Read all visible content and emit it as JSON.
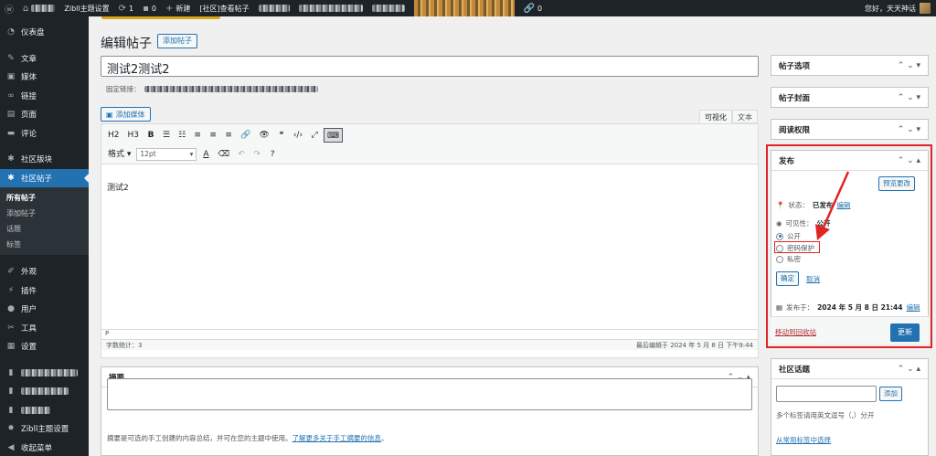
{
  "admin_bar": {
    "items": [
      {
        "icon": "wordpress-icon",
        "label": ""
      },
      {
        "icon": "home-icon",
        "label": "",
        "blurred": true
      },
      {
        "icon": "",
        "label": "Zibll主题设置"
      },
      {
        "icon": "refresh-icon",
        "label": "1"
      },
      {
        "icon": "comment-icon",
        "label": "0"
      },
      {
        "icon": "plus-icon",
        "label": "新建"
      },
      {
        "icon": "",
        "label": "[社区]查看帖子"
      }
    ],
    "links_count": "0",
    "greeting": "您好，天天神话"
  },
  "sidebar": {
    "items": [
      {
        "icon": "dashboard-icon",
        "label": "仪表盘"
      },
      {
        "sep": true
      },
      {
        "icon": "pin-icon",
        "label": "文章"
      },
      {
        "icon": "media-icon",
        "label": "媒体"
      },
      {
        "icon": "link-icon",
        "label": "链接"
      },
      {
        "icon": "page-icon",
        "label": "页面"
      },
      {
        "icon": "comment-icon",
        "label": "评论"
      },
      {
        "sep": true
      },
      {
        "icon": "forum-icon",
        "label": "社区版块"
      },
      {
        "icon": "forum-post-icon",
        "label": "社区帖子",
        "active": true
      },
      {
        "sub": [
          "所有帖子",
          "添加帖子",
          "话题",
          "标签"
        ]
      },
      {
        "sep": true
      },
      {
        "icon": "brush-icon",
        "label": "外观"
      },
      {
        "icon": "plugin-icon",
        "label": "插件"
      },
      {
        "icon": "user-icon",
        "label": "用户"
      },
      {
        "icon": "tool-icon",
        "label": "工具"
      },
      {
        "icon": "settings-icon",
        "label": "设置"
      },
      {
        "sep": true
      },
      {
        "icon": "blurred-icon",
        "label": "",
        "blurred": true
      },
      {
        "icon": "blurred-icon",
        "label": "",
        "blurred": true
      },
      {
        "icon": "blurred-icon",
        "label": "",
        "blurred": true
      },
      {
        "icon": "gear-icon",
        "label": "Zibll主题设置"
      },
      {
        "icon": "collapse-icon",
        "label": "收起菜单"
      }
    ]
  },
  "page": {
    "title": "编辑帖子",
    "add_new": "添加帖子",
    "post_title": "测试2测试2",
    "permalink_label": "固定链接：",
    "add_media": "添加媒体",
    "tab_visual": "可视化",
    "tab_text": "文本"
  },
  "toolbar": {
    "row1": [
      "H2",
      "H3",
      "B",
      "☰",
      "☷",
      "≡",
      "≡",
      "≡",
      "🔗",
      "👁",
      "❝",
      "‹/›",
      "⤢",
      "⌨"
    ],
    "format": "格式",
    "font_size": "12pt",
    "row2_icons": [
      "A",
      "⌫",
      "↶",
      "↷",
      "?"
    ]
  },
  "editor": {
    "content": "测试2",
    "path": "P",
    "word_count": "字数统计：3",
    "last_edit": "最后编辑于 2024 年 5 月 8 日 下午9:44"
  },
  "excerpt": {
    "title": "摘要",
    "help_text": "摘要是可选的手工创建的内容总结，并可在您的主题中使用。",
    "help_link": "了解更多关于手工摘要的信息",
    "help_end": "。"
  },
  "right_panels": {
    "post_options": "帖子选项",
    "post_cover": "帖子封面",
    "read_permission": "阅读权限",
    "forum_topics": "社区话题"
  },
  "publish": {
    "title": "发布",
    "preview": "预览更改",
    "status_label": "状态：",
    "status_value": "已发布",
    "edit": "编辑",
    "visibility_label": "可见性：",
    "visibility_value": "公开",
    "options": [
      {
        "label": "公开",
        "checked": true
      },
      {
        "label": "密码保护",
        "checked": false
      },
      {
        "label": "私密",
        "checked": false
      }
    ],
    "ok": "确定",
    "cancel": "取消",
    "published_on_label": "发布于：",
    "published_on_value": "2024 年 5 月 8 日 21:44",
    "trash": "移动到回收站",
    "update": "更新"
  },
  "topics": {
    "add": "添加",
    "hint": "多个标签请用英文逗号（,）分开",
    "choose": "从常用标签中选择"
  },
  "colors": {
    "accent": "#2271b1",
    "admin_dark": "#1d2327",
    "annotation": "#e02424"
  }
}
